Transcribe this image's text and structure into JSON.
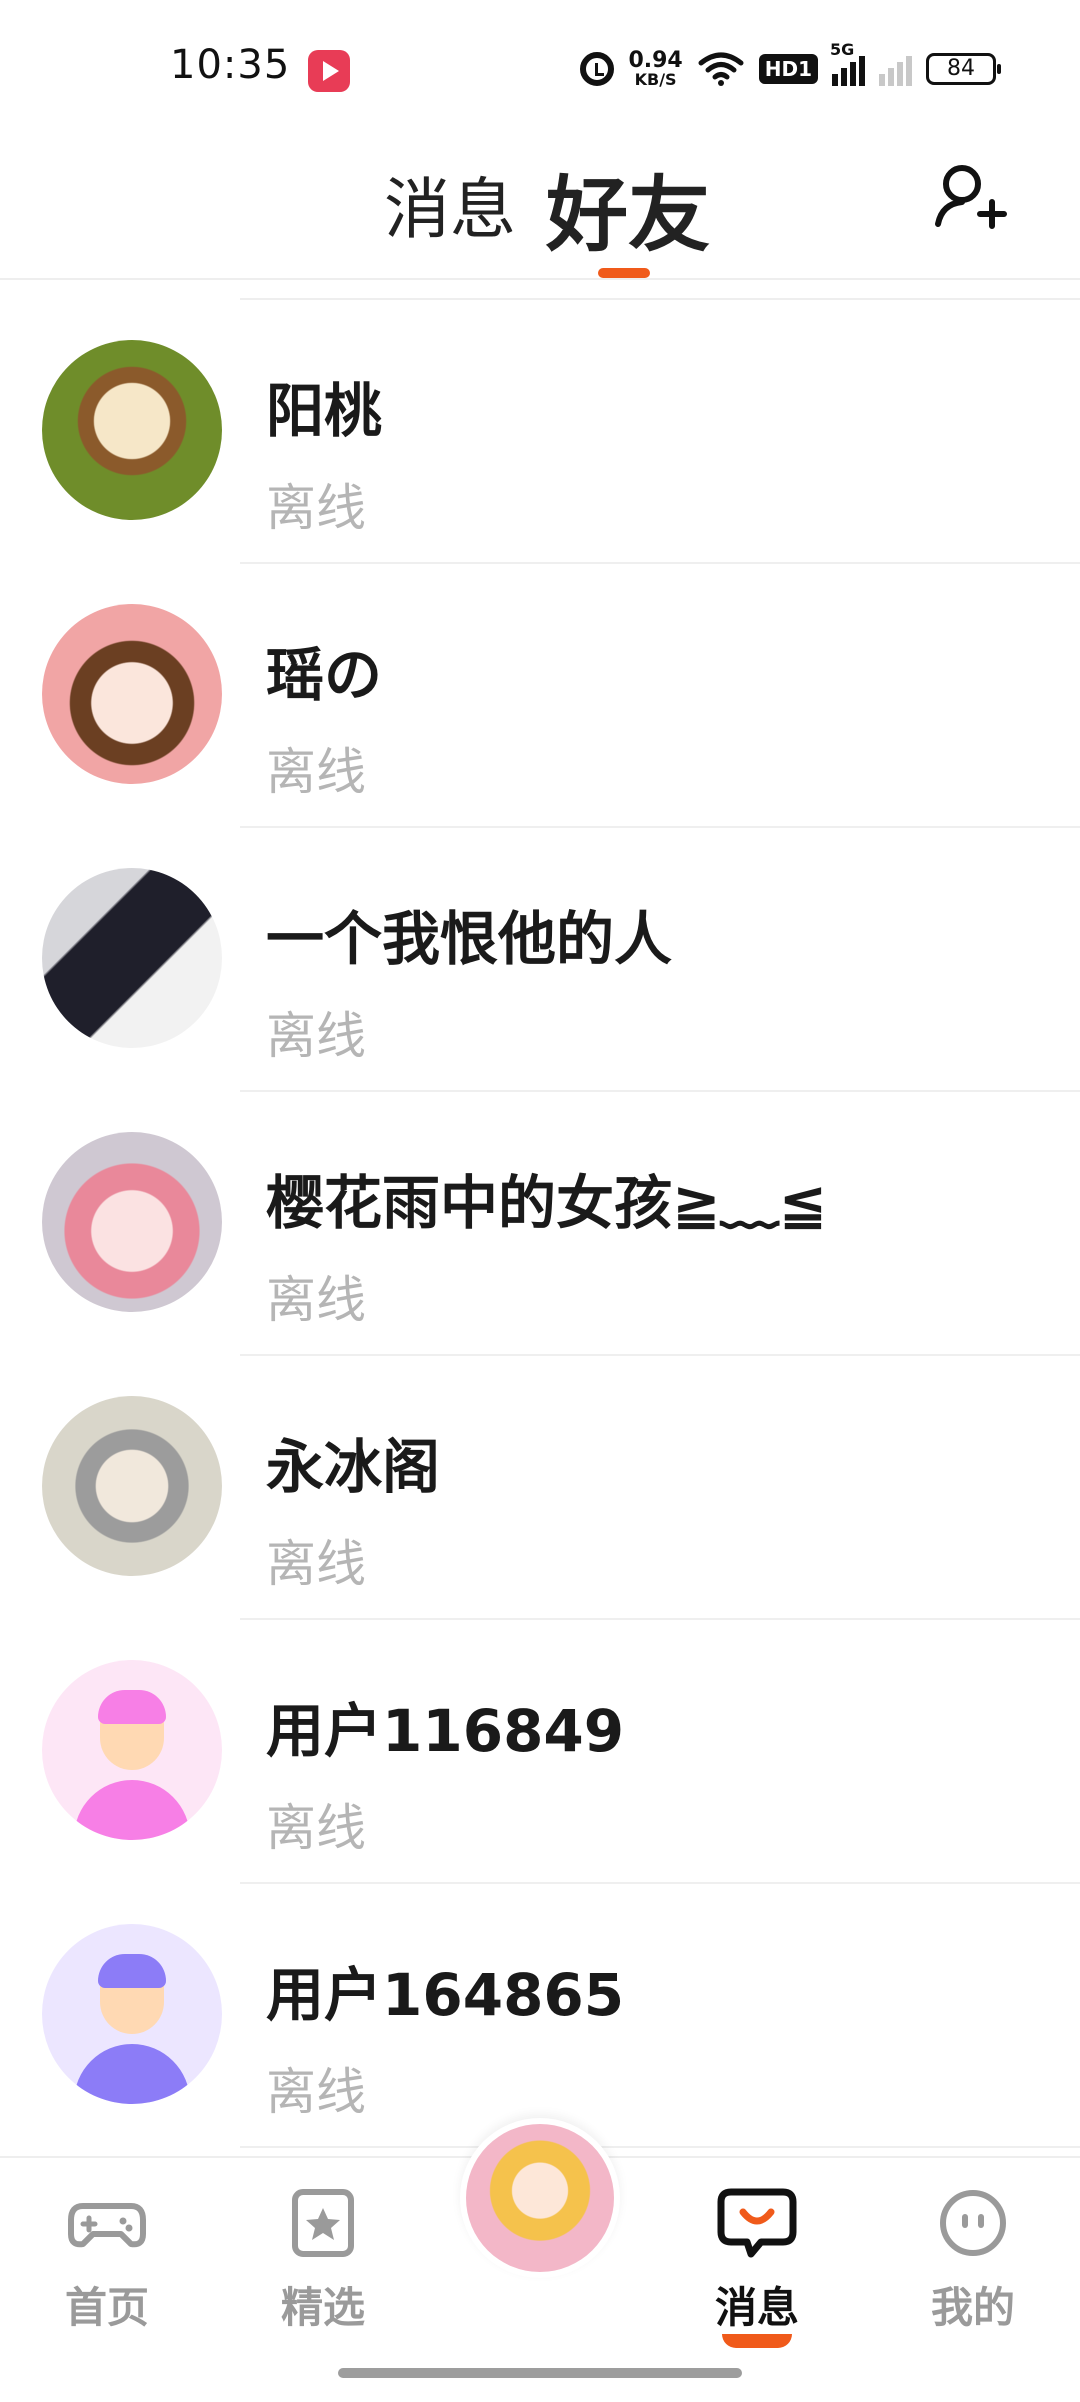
{
  "status_bar": {
    "time": "10:35",
    "net_speed_value": "0.94",
    "net_speed_unit": "KB/S",
    "hd_label": "HD1",
    "signal_label": "5G",
    "battery": "84"
  },
  "header": {
    "tab_messages": "消息",
    "tab_friends": "好友",
    "active_tab": "好友",
    "accent_color": "#f05a1a"
  },
  "friends": [
    {
      "name": "阳桃",
      "status": "离线"
    },
    {
      "name": "瑶の",
      "status": "离线"
    },
    {
      "name": "一个我恨他的人",
      "status": "离线"
    },
    {
      "name": "樱花雨中的女孩≧﹏≦",
      "status": "离线"
    },
    {
      "name": "永冰阁",
      "status": "离线"
    },
    {
      "name": "用户116849",
      "status": "离线"
    },
    {
      "name": "用户164865",
      "status": "离线"
    }
  ],
  "bottom_nav": {
    "home": "首页",
    "featured": "精选",
    "messages": "消息",
    "me": "我的",
    "active": "消息"
  }
}
